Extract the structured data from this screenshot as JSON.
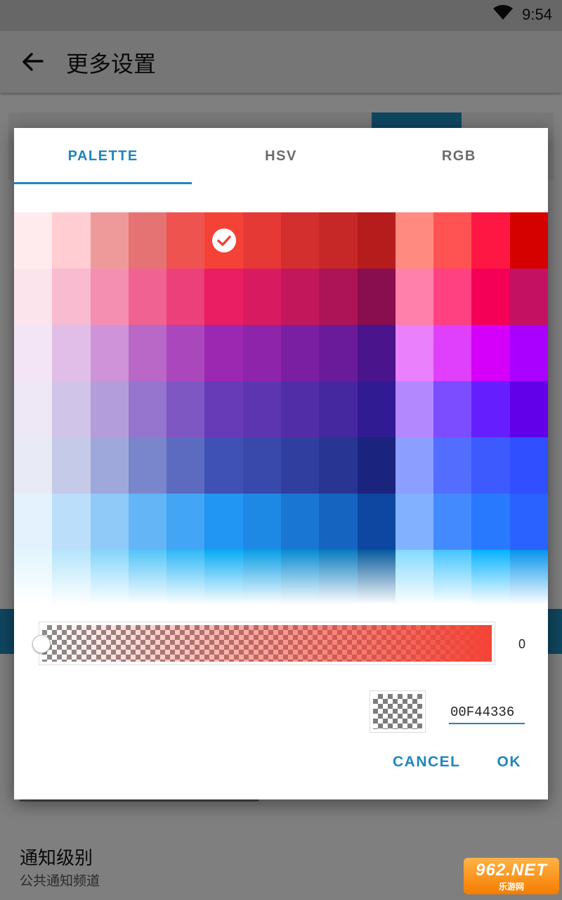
{
  "status_bar": {
    "time": "9:54",
    "wifi_icon": "wifi-icon"
  },
  "app_bar": {
    "title": "更多设置",
    "back_icon": "arrow-back-icon"
  },
  "background_list": {
    "item_title": "通知级别",
    "item_subtitle": "公共通知频道"
  },
  "watermark": {
    "line1": "962.NET",
    "line2": "乐游网"
  },
  "dialog": {
    "tabs": [
      {
        "label": "PALETTE",
        "active": true
      },
      {
        "label": "HSV",
        "active": false
      },
      {
        "label": "RGB",
        "active": false
      }
    ],
    "palette": {
      "selected_color": "#F44336",
      "rows": [
        [
          "#FFEBEE",
          "#FFCDD2",
          "#EF9A9A",
          "#E57373",
          "#EF5350",
          "#F44336",
          "#E53935",
          "#D32F2F",
          "#C62828",
          "#B71C1C",
          "#FF8A80",
          "#FF5252",
          "#FF1744",
          "#D50000"
        ],
        [
          "#FCE4EC",
          "#F8BBD0",
          "#F48FB1",
          "#F06292",
          "#EC407A",
          "#E91E63",
          "#D81B60",
          "#C2185B",
          "#AD1457",
          "#880E4F",
          "#FF80AB",
          "#FF4081",
          "#F50057",
          "#C51162"
        ],
        [
          "#F3E5F5",
          "#E1BEE7",
          "#CE93D8",
          "#BA68C8",
          "#AB47BC",
          "#9C27B0",
          "#8E24AA",
          "#7B1FA2",
          "#6A1B9A",
          "#4A148C",
          "#EA80FC",
          "#E040FB",
          "#D500F9",
          "#AA00FF"
        ],
        [
          "#EDE7F6",
          "#D1C4E9",
          "#B39DDB",
          "#9575CD",
          "#7E57C2",
          "#673AB7",
          "#5E35B1",
          "#512DA8",
          "#4527A0",
          "#311B92",
          "#B388FF",
          "#7C4DFF",
          "#651FFF",
          "#6200EA"
        ],
        [
          "#E8EAF6",
          "#C5CAE9",
          "#9FA8DA",
          "#7986CB",
          "#5C6BC0",
          "#3F51B5",
          "#3949AB",
          "#303F9F",
          "#283593",
          "#1A237E",
          "#8C9EFF",
          "#536DFE",
          "#3D5AFE",
          "#304FFE"
        ],
        [
          "#E3F2FD",
          "#BBDEFB",
          "#90CAF9",
          "#64B5F6",
          "#42A5F5",
          "#2196F3",
          "#1E88E5",
          "#1976D2",
          "#1565C0",
          "#0D47A1",
          "#82B1FF",
          "#448AFF",
          "#2979FF",
          "#2962FF"
        ],
        [
          "#E1F5FE",
          "#B3E5FC",
          "#81D4FA",
          "#4FC3F7",
          "#29B6F6",
          "#03A9F4",
          "#039BE5",
          "#0288D1",
          "#0277BD",
          "#01579B",
          "#80D8FF",
          "#40C4FF",
          "#00B0FF",
          "#0091EA"
        ]
      ]
    },
    "alpha": {
      "value": "0",
      "level": 0
    },
    "hex_value": "00F44336",
    "buttons": {
      "cancel": "CANCEL",
      "ok": "OK"
    }
  }
}
